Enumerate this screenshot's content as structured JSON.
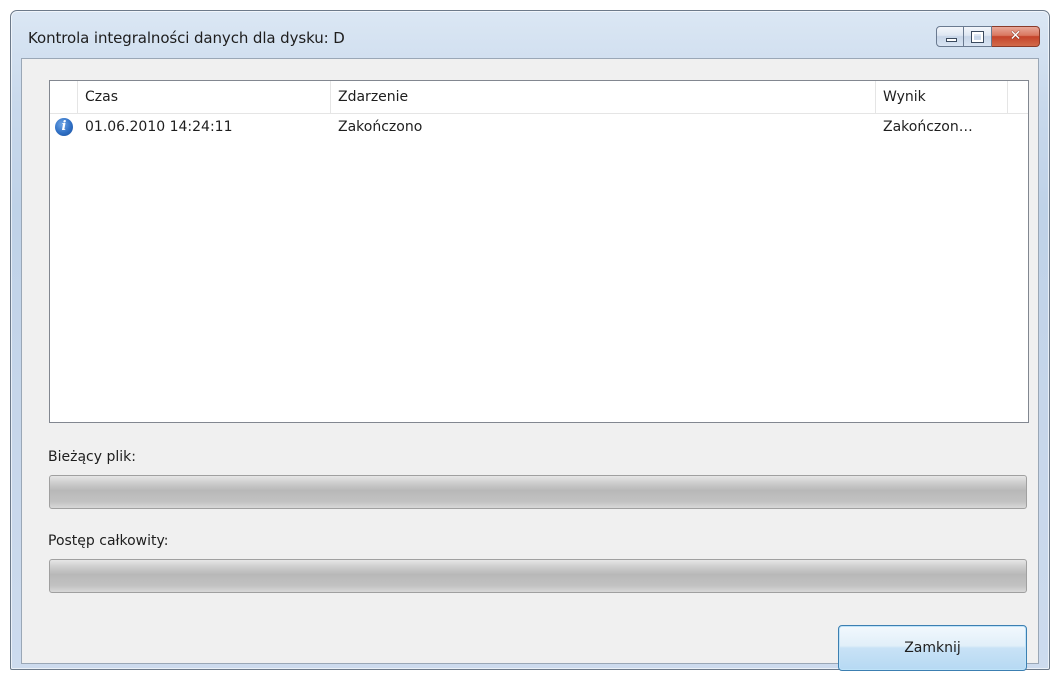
{
  "window": {
    "title": "Kontrola integralności danych dla dysku: D",
    "close_glyph": "✕"
  },
  "list": {
    "columns": [
      "Czas",
      "Zdarzenie",
      "Wynik"
    ],
    "rows": [
      {
        "icon": "info-icon",
        "icon_glyph": "i",
        "czas": "01.06.2010 14:24:11",
        "zdarzenie": "Zakończono",
        "wynik": "Zakończon…"
      }
    ]
  },
  "progress": {
    "current_file_label": "Bieżący plik:",
    "current_file_value": 0,
    "total_label": "Postęp całkowity:",
    "total_value": 0
  },
  "buttons": {
    "close_label": "Zamknij"
  },
  "colors": {
    "close_button_red": "#c4432a",
    "info_icon_blue": "#2f6fc4",
    "button_border": "#3c7fb1"
  }
}
